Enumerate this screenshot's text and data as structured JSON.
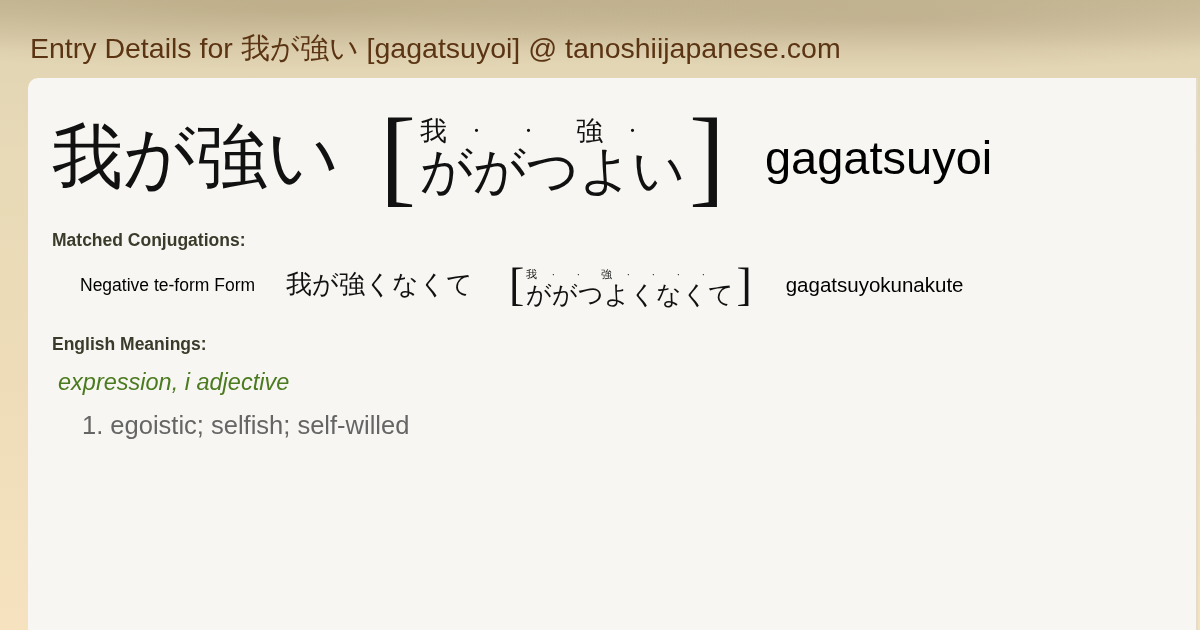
{
  "page_title": "Entry Details for 我が強い [gagatsuyoi] @ tanoshiijapanese.com",
  "entry": {
    "word": "我が強い",
    "reading": {
      "open": "[",
      "kana": "ががつよい",
      "furigana": [
        "我",
        "·",
        "·",
        "強",
        "·"
      ],
      "close": "]"
    },
    "romaji": "gagatsuyoi"
  },
  "conjugations": {
    "heading": "Matched Conjugations:",
    "items": [
      {
        "form": "Negative te-form Form",
        "word": "我が強くなくて",
        "reading": {
          "open": "[",
          "kana": "ががつよくなくて",
          "furigana": [
            "我",
            "·",
            "·",
            "強",
            "·",
            "·",
            "·",
            "·"
          ],
          "close": "]"
        },
        "romaji": "gagatsuyokunakute"
      }
    ]
  },
  "meanings": {
    "heading": "English Meanings:",
    "groups": [
      {
        "pos": "expression, i adjective",
        "senses": [
          "1. egoistic; selfish; self-willed"
        ]
      }
    ]
  }
}
